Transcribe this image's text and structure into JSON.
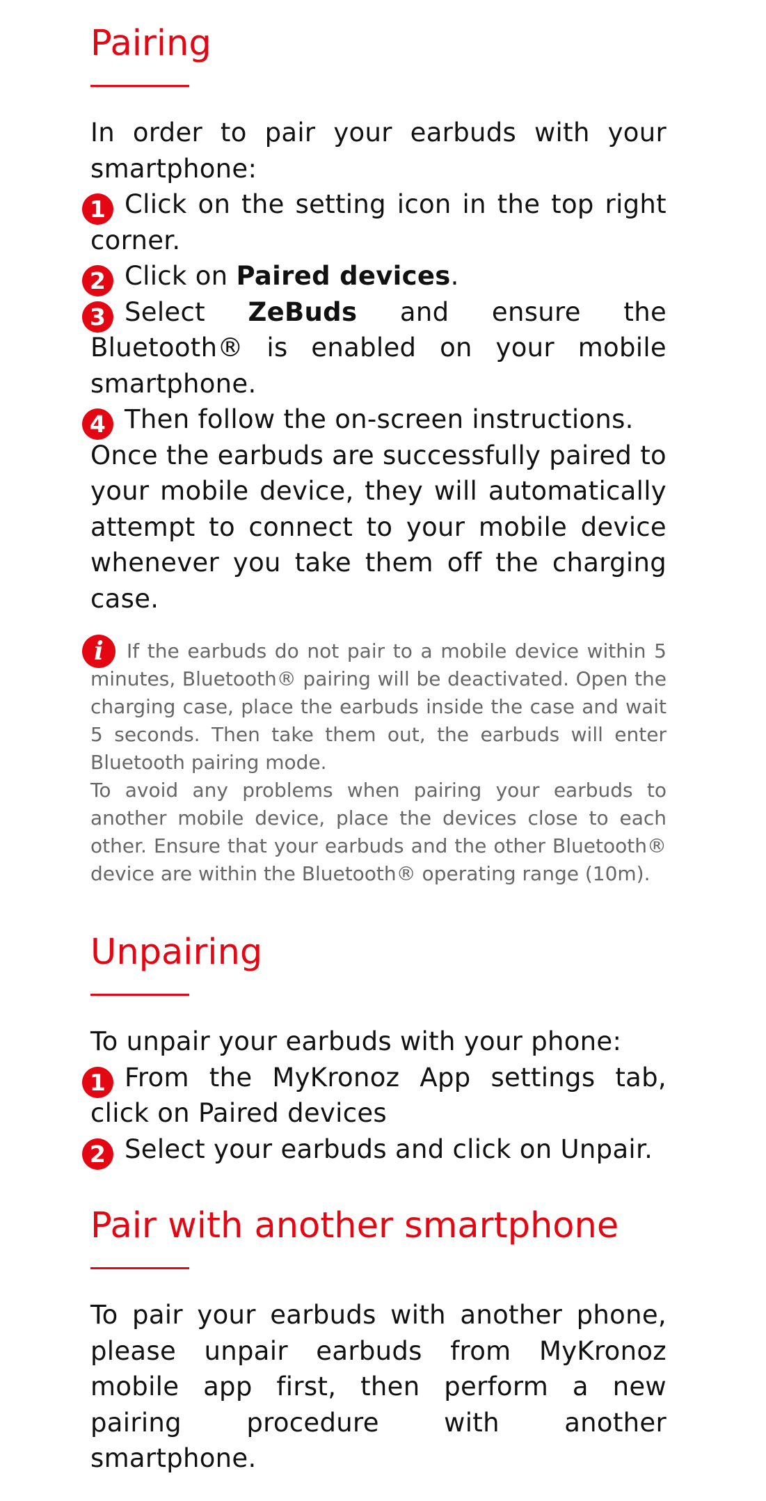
{
  "pairing": {
    "title": "Pairing",
    "intro": "In order to pair your earbuds with your smartphone:",
    "step1": {
      "num": "1",
      "text": "Click on the setting icon in the top right corner."
    },
    "step2": {
      "num": "2",
      "before": "Click on ",
      "bold": "Paired devices",
      "after": "."
    },
    "step3": {
      "num": "3",
      "before": "Select ",
      "bold": "ZeBuds",
      "after": " and ensure the Bluetooth® is enabled on your mobile smartphone."
    },
    "step4": {
      "num": "4",
      "text": "Then follow the on-screen instructions."
    },
    "after": "Once the earbuds are successfully paired to your mobile device, they will automatically attempt to connect to your mobile device whenever you take them off the charging case.",
    "note_icon": "i",
    "note1": "If the earbuds do not pair to a mobile device within 5 minutes, Bluetooth® pairing will be deactivated. Open the charging case, place the earbuds inside the case and wait 5 seconds. Then take them out, the earbuds will enter Bluetooth pairing mode.",
    "note2": "To avoid any problems when pairing your earbuds to another mobile device, place the devices close to each other. Ensure that your earbuds and the other Bluetooth® device are within the Bluetooth® operating range (10m)."
  },
  "unpairing": {
    "title": "Unpairing",
    "intro": "To unpair your earbuds with your phone:",
    "step1": {
      "num": "1",
      "text": "From the MyKronoz App settings tab, click on Paired devices"
    },
    "step2": {
      "num": "2",
      "text": "Select your earbuds and click on Unpair."
    }
  },
  "another": {
    "title": "Pair with another smartphone",
    "text": "To pair your earbuds with another phone, please unpair earbuds from MyKronoz mobile app first, then perform a new pairing procedure with another smartphone."
  },
  "colors": {
    "accent": "#e30613",
    "text": "#111111",
    "note": "#666666"
  }
}
